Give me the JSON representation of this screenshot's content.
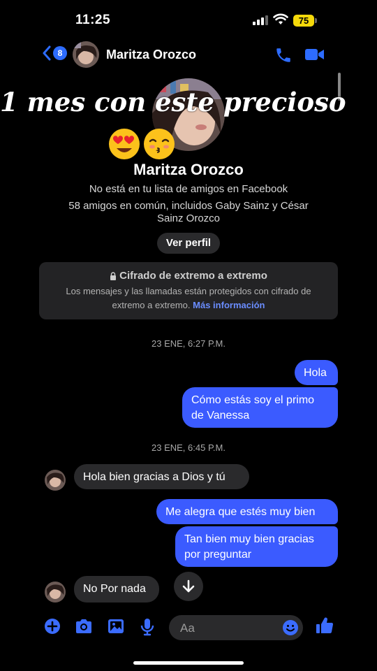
{
  "status_bar": {
    "time": "11:25",
    "battery": "75"
  },
  "header": {
    "back_count": "8",
    "contact_name": "Maritza Orozco"
  },
  "overlay": {
    "caption": "1 mes con este precioso"
  },
  "profile": {
    "name": "Maritza Orozco",
    "not_friends": "No está en tu lista de amigos en Facebook",
    "mutual_line1": "58 amigos en común, incluidos Gaby Sainz y César",
    "mutual_line2": "Sainz Orozco",
    "view_profile": "Ver perfil"
  },
  "encryption": {
    "title": "Cifrado de extremo a extremo",
    "desc": "Los mensajes y las llamadas están protegidos con cifrado de extremo a extremo.",
    "link": "Más información"
  },
  "timestamps": [
    "23 ENE, 6:27 P.M.",
    "23 ENE, 6:45 P.M."
  ],
  "messages": [
    {
      "direction": "out",
      "text": "Hola"
    },
    {
      "direction": "out",
      "text": "Cómo estás soy el primo de Vanessa"
    },
    {
      "direction": "in",
      "text": "Hola bien gracias a Dios y tú"
    },
    {
      "direction": "out",
      "text": "Me alegra que estés muy bien"
    },
    {
      "direction": "out",
      "text": "Tan bien muy bien gracias por preguntar"
    },
    {
      "direction": "in",
      "text": "No Por nada"
    }
  ],
  "composer": {
    "placeholder": "Aa"
  },
  "colors": {
    "accent": "#2d6cff",
    "bubble_out": "#3b5bff",
    "bubble_in": "#2a2a2c",
    "background": "#000000"
  }
}
